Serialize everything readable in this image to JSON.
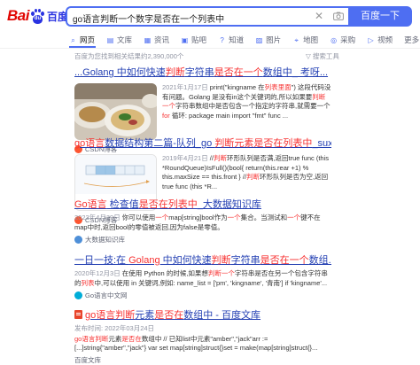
{
  "logo": {
    "bai": "Bai",
    "du": "百度",
    "paw_text": "du"
  },
  "search": {
    "query": "go语言判断一个数字是否在一个列表中",
    "button_label": "百度一下"
  },
  "tabs": [
    {
      "label": "网页",
      "icon": "search-icon",
      "glyph": "⌕",
      "active": true
    },
    {
      "label": "文库",
      "icon": "document-icon",
      "glyph": "▤",
      "active": false
    },
    {
      "label": "资讯",
      "icon": "news-icon",
      "glyph": "▦",
      "active": false
    },
    {
      "label": "贴吧",
      "icon": "tieba-icon",
      "glyph": "▣",
      "active": false
    },
    {
      "label": "知道",
      "icon": "question-icon",
      "glyph": "?",
      "active": false
    },
    {
      "label": "图片",
      "icon": "image-icon",
      "glyph": "▨",
      "active": false
    },
    {
      "label": "地图",
      "icon": "map-pin-icon",
      "glyph": "⌖",
      "active": false
    },
    {
      "label": "采购",
      "icon": "shopping-icon",
      "glyph": "◎",
      "active": false
    },
    {
      "label": "视频",
      "icon": "video-icon",
      "glyph": "▷",
      "active": false
    },
    {
      "label": "更多",
      "icon": "",
      "glyph": "",
      "active": false
    }
  ],
  "result_count": "百度为您找到相关结果约2,390,000个",
  "tools_label": "搜索工具",
  "results": [
    {
      "title_parts": [
        {
          "text": "...Golang 中如何快速",
          "hl": false
        },
        {
          "text": "判断",
          "hl": true
        },
        {
          "text": "字符串",
          "hl": false
        },
        {
          "text": "是否在一个",
          "hl": true
        },
        {
          "text": "数组中_ 考呀...",
          "hl": false
        }
      ],
      "body_parts": [
        {
          "text": "2021年1月17日 ",
          "kind": "date"
        },
        {
          "text": "print(\"kingname 在",
          "kind": "text"
        },
        {
          "text": "列表里面",
          "kind": "hl"
        },
        {
          "text": "\") 这段代码没有问题。Golang 是没有in这个关键词的,所以如果要",
          "kind": "text"
        },
        {
          "text": "判断一个",
          "kind": "hl"
        },
        {
          "text": "字符串数组中是否包含一个指定的字符串,就需要一个",
          "kind": "text"
        },
        {
          "text": "for",
          "kind": "hl"
        },
        {
          "text": " 循环: package main import \"fmt\" func ...",
          "kind": "text"
        }
      ],
      "source": "CSDN博客"
    },
    {
      "title_parts": [
        {
          "text": "go语言",
          "hl": true
        },
        {
          "text": "数据结构第二篇-队列_go ",
          "hl": false
        },
        {
          "text": "判断元素是否在列表中",
          "hl": true
        },
        {
          "text": "_suxu...",
          "hl": false
        }
      ],
      "body_parts": [
        {
          "text": "2019年4月21日 ",
          "kind": "date"
        },
        {
          "text": "//",
          "kind": "text"
        },
        {
          "text": "判断",
          "kind": "hl"
        },
        {
          "text": "环形队列是否满,返回true func (this *RoundQueue)IsFull()(bool{ return(this.rear +1) % this.maxSize == this.front } //",
          "kind": "text"
        },
        {
          "text": "判断",
          "kind": "hl"
        },
        {
          "text": "环形队列是否为空,返回true func (this *R...",
          "kind": "text"
        }
      ],
      "source": "CSDN博客"
    },
    {
      "title_parts": [
        {
          "text": "Go语言",
          "hl": true
        },
        {
          "text": " 检查值",
          "hl": false
        },
        {
          "text": "是否在列表中",
          "hl": true
        },
        {
          "text": "_大数据知识库",
          "hl": false
        }
      ],
      "snippet_parts": [
        {
          "text": "2023年4月29日 ",
          "kind": "date"
        },
        {
          "text": "你可以使用",
          "kind": "text"
        },
        {
          "text": "一个",
          "kind": "hl"
        },
        {
          "text": "map[string]bool作为",
          "kind": "text"
        },
        {
          "text": "一个",
          "kind": "hl"
        },
        {
          "text": "集合。当测试和",
          "kind": "text"
        },
        {
          "text": "一个",
          "kind": "hl"
        },
        {
          "text": "键不在map中时,返回bool的零值被返回,因为false是零值。",
          "kind": "text"
        }
      ],
      "source": "大数据知识库"
    },
    {
      "title_parts": [
        {
          "text": "一日一技:在 ",
          "hl": false
        },
        {
          "text": "Golang",
          "hl": true
        },
        {
          "text": " 中如何快速",
          "hl": false
        },
        {
          "text": "判断",
          "hl": true
        },
        {
          "text": "字符串",
          "hl": false
        },
        {
          "text": "是否在一个",
          "hl": true
        },
        {
          "text": "数组...",
          "hl": false
        }
      ],
      "snippet_parts": [
        {
          "text": "2020年12月3日 ",
          "kind": "date"
        },
        {
          "text": "在使用 Python 的时候,如果想",
          "kind": "text"
        },
        {
          "text": "判断一个",
          "kind": "hl"
        },
        {
          "text": "字符串是否在另一个包含字符串的",
          "kind": "text"
        },
        {
          "text": "列表",
          "kind": "hl"
        },
        {
          "text": "中,可以使用 in 关键词,例如: name_list = ['pm', 'kingname', '青南'] if 'kingname'...",
          "kind": "text"
        }
      ],
      "source": "Go语言中文网"
    },
    {
      "title_parts": [
        {
          "text": "go语言判断",
          "hl": true
        },
        {
          "text": "元素",
          "hl": false
        },
        {
          "text": "是否在",
          "hl": true
        },
        {
          "text": "数组中 - 百度文库",
          "hl": false
        }
      ],
      "snippet_parts": [
        {
          "text": "发布时间: 2022年03月24日",
          "kind": "date"
        }
      ],
      "snippet2_parts": [
        {
          "text": "go语言判断",
          "kind": "hl"
        },
        {
          "text": "元素",
          "kind": "text"
        },
        {
          "text": "是否在",
          "kind": "hl"
        },
        {
          "text": "数组中 // 已知list中元素\"amber\",\"jack\"arr := [...]string{\"amber\",\"jack\"} var set map[string]struct{}set = make(map[string]struct{}...",
          "kind": "text"
        }
      ],
      "source": "百度文库"
    }
  ]
}
